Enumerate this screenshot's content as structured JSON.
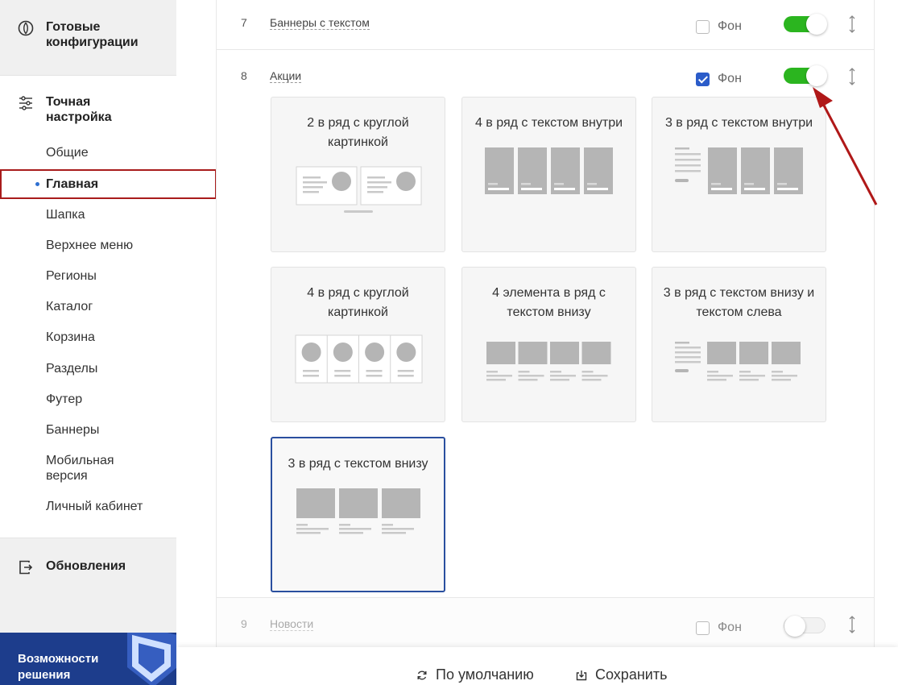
{
  "sidebar": {
    "ready_configs": "Готовые конфигурации",
    "fine_tuning": "Точная настройка",
    "items": [
      {
        "label": "Общие"
      },
      {
        "label": "Главная"
      },
      {
        "label": "Шапка"
      },
      {
        "label": "Верхнее меню"
      },
      {
        "label": "Регионы"
      },
      {
        "label": "Каталог"
      },
      {
        "label": "Корзина"
      },
      {
        "label": "Разделы"
      },
      {
        "label": "Футер"
      },
      {
        "label": "Баннеры"
      },
      {
        "label": "Мобильная версия"
      },
      {
        "label": "Личный кабинет"
      }
    ],
    "active_item": "Главная",
    "updates": "Обновления",
    "promo": "Возможности решения"
  },
  "rows": [
    {
      "number": "7",
      "name": "Баннеры с текстом",
      "fon_label": "Фон",
      "fon_checked": false,
      "enabled": true
    },
    {
      "number": "8",
      "name": "Акции",
      "fon_label": "Фон",
      "fon_checked": true,
      "enabled": true
    },
    {
      "number": "9",
      "name": "Новости",
      "fon_label": "Фон",
      "fon_checked": false,
      "enabled": false
    }
  ],
  "templates": [
    {
      "title": "2 в ряд с круглой картинкой",
      "preview": "two-round",
      "selected": false
    },
    {
      "title": "4 в ряд с текстом внутри",
      "preview": "four-inside",
      "selected": false
    },
    {
      "title": "3 в ряд с текстом внутри",
      "preview": "three-inside-left",
      "selected": false
    },
    {
      "title": "4 в ряд с круглой картинкой",
      "preview": "four-round",
      "selected": false
    },
    {
      "title": "4 элемента в ряд с текстом внизу",
      "preview": "four-below",
      "selected": false
    },
    {
      "title": "3 в ряд с текстом внизу и текстом слева",
      "preview": "three-below-left",
      "selected": false
    },
    {
      "title": "3 в ряд с текстом внизу",
      "preview": "three-below",
      "selected": true
    }
  ],
  "footer": {
    "default_label": "По умолчанию",
    "save_label": "Сохранить"
  },
  "colors": {
    "toggle_on": "#2bb51f",
    "checkbox_checked": "#2b5cc9",
    "highlight": "#a81c1c",
    "selected_card": "#2a4f9f"
  }
}
